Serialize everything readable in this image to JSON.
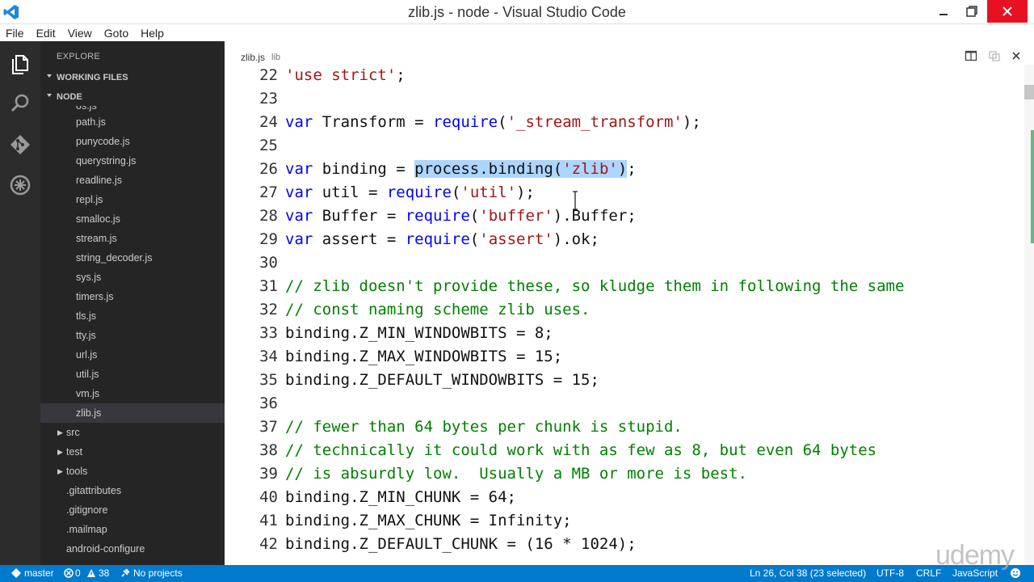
{
  "window": {
    "title": "zlib.js - node - Visual Studio Code",
    "app_icon": "vscode-logo-icon",
    "controls": [
      "minimize-icon",
      "maximize-icon",
      "close-icon"
    ]
  },
  "menu": [
    "File",
    "Edit",
    "View",
    "Goto",
    "Help"
  ],
  "activity_bar": [
    "files-icon",
    "search-icon",
    "git-icon",
    "debug-icon"
  ],
  "sidebar": {
    "title": "EXPLORE",
    "working_files": "WORKING FILES",
    "project": "NODE",
    "items": [
      {
        "label": "os.js",
        "type": "file"
      },
      {
        "label": "path.js",
        "type": "file"
      },
      {
        "label": "punycode.js",
        "type": "file"
      },
      {
        "label": "querystring.js",
        "type": "file"
      },
      {
        "label": "readline.js",
        "type": "file"
      },
      {
        "label": "repl.js",
        "type": "file"
      },
      {
        "label": "smalloc.js",
        "type": "file"
      },
      {
        "label": "stream.js",
        "type": "file"
      },
      {
        "label": "string_decoder.js",
        "type": "file"
      },
      {
        "label": "sys.js",
        "type": "file"
      },
      {
        "label": "timers.js",
        "type": "file"
      },
      {
        "label": "tls.js",
        "type": "file"
      },
      {
        "label": "tty.js",
        "type": "file"
      },
      {
        "label": "url.js",
        "type": "file"
      },
      {
        "label": "util.js",
        "type": "file"
      },
      {
        "label": "vm.js",
        "type": "file"
      },
      {
        "label": "zlib.js",
        "type": "file",
        "active": true
      },
      {
        "label": "src",
        "type": "folder"
      },
      {
        "label": "test",
        "type": "folder"
      },
      {
        "label": "tools",
        "type": "folder"
      },
      {
        "label": ".gitattributes",
        "type": "rootfile"
      },
      {
        "label": ".gitignore",
        "type": "rootfile"
      },
      {
        "label": ".mailmap",
        "type": "rootfile"
      },
      {
        "label": "android-configure",
        "type": "rootfile"
      }
    ]
  },
  "editor": {
    "tab_name": "zlib.js",
    "tab_dir": "lib",
    "lines": [
      {
        "n": "22",
        "segs": [
          [
            "str",
            "'use strict'"
          ],
          [
            "p",
            ";"
          ]
        ]
      },
      {
        "n": "23",
        "segs": []
      },
      {
        "n": "24",
        "segs": [
          [
            "kw",
            "var"
          ],
          [
            "p",
            " Transform = "
          ],
          [
            "kw",
            "require"
          ],
          [
            "p",
            "("
          ],
          [
            "str",
            "'_stream_transform'"
          ],
          [
            "p",
            ");"
          ]
        ]
      },
      {
        "n": "25",
        "segs": []
      },
      {
        "n": "26",
        "segs": [
          [
            "kw",
            "var"
          ],
          [
            "p",
            " binding = "
          ],
          [
            "sel",
            "process.binding("
          ],
          [
            "selstr",
            "'zlib'"
          ],
          [
            "sel",
            ")"
          ],
          [
            "p",
            ";"
          ]
        ]
      },
      {
        "n": "27",
        "segs": [
          [
            "kw",
            "var"
          ],
          [
            "p",
            " util = "
          ],
          [
            "kw",
            "require"
          ],
          [
            "p",
            "("
          ],
          [
            "str",
            "'util'"
          ],
          [
            "p",
            ");"
          ]
        ]
      },
      {
        "n": "28",
        "segs": [
          [
            "kw",
            "var"
          ],
          [
            "p",
            " Buffer = "
          ],
          [
            "kw",
            "require"
          ],
          [
            "p",
            "("
          ],
          [
            "str",
            "'buffer'"
          ],
          [
            "p",
            ").Buffer;"
          ]
        ]
      },
      {
        "n": "29",
        "segs": [
          [
            "kw",
            "var"
          ],
          [
            "p",
            " assert = "
          ],
          [
            "kw",
            "require"
          ],
          [
            "p",
            "("
          ],
          [
            "str",
            "'assert'"
          ],
          [
            "p",
            ").ok;"
          ]
        ]
      },
      {
        "n": "30",
        "segs": []
      },
      {
        "n": "31",
        "segs": [
          [
            "cm",
            "// zlib doesn't provide these, so kludge them in following the same"
          ]
        ]
      },
      {
        "n": "32",
        "segs": [
          [
            "cm",
            "// const naming scheme zlib uses."
          ]
        ]
      },
      {
        "n": "33",
        "segs": [
          [
            "p",
            "binding.Z_MIN_WINDOWBITS = 8;"
          ]
        ]
      },
      {
        "n": "34",
        "segs": [
          [
            "p",
            "binding.Z_MAX_WINDOWBITS = 15;"
          ]
        ]
      },
      {
        "n": "35",
        "segs": [
          [
            "p",
            "binding.Z_DEFAULT_WINDOWBITS = 15;"
          ]
        ]
      },
      {
        "n": "36",
        "segs": []
      },
      {
        "n": "37",
        "segs": [
          [
            "cm",
            "// fewer than 64 bytes per chunk is stupid."
          ]
        ]
      },
      {
        "n": "38",
        "segs": [
          [
            "cm",
            "// technically it could work with as few as 8, but even 64 bytes"
          ]
        ]
      },
      {
        "n": "39",
        "segs": [
          [
            "cm",
            "// is absurdly low.  Usually a MB or more is best."
          ]
        ]
      },
      {
        "n": "40",
        "segs": [
          [
            "p",
            "binding.Z_MIN_CHUNK = 64;"
          ]
        ]
      },
      {
        "n": "41",
        "segs": [
          [
            "p",
            "binding.Z_MAX_CHUNK = Infinity;"
          ]
        ]
      },
      {
        "n": "42",
        "segs": [
          [
            "p",
            "binding.Z_DEFAULT_CHUNK = (16 * 1024);"
          ]
        ]
      }
    ],
    "colors": {
      "keyword": "#0000ff",
      "string": "#a31515",
      "comment": "#008000",
      "selection": "#add6ff"
    }
  },
  "statusbar": {
    "branch": "master",
    "errors": "0",
    "warnings": "38",
    "projects": "No projects",
    "position": "Ln 26, Col 38 (23 selected)",
    "encoding": "UTF-8",
    "eol": "CRLF",
    "language": "JavaScript"
  },
  "watermark": "udemy",
  "accent_color": "#007acc"
}
